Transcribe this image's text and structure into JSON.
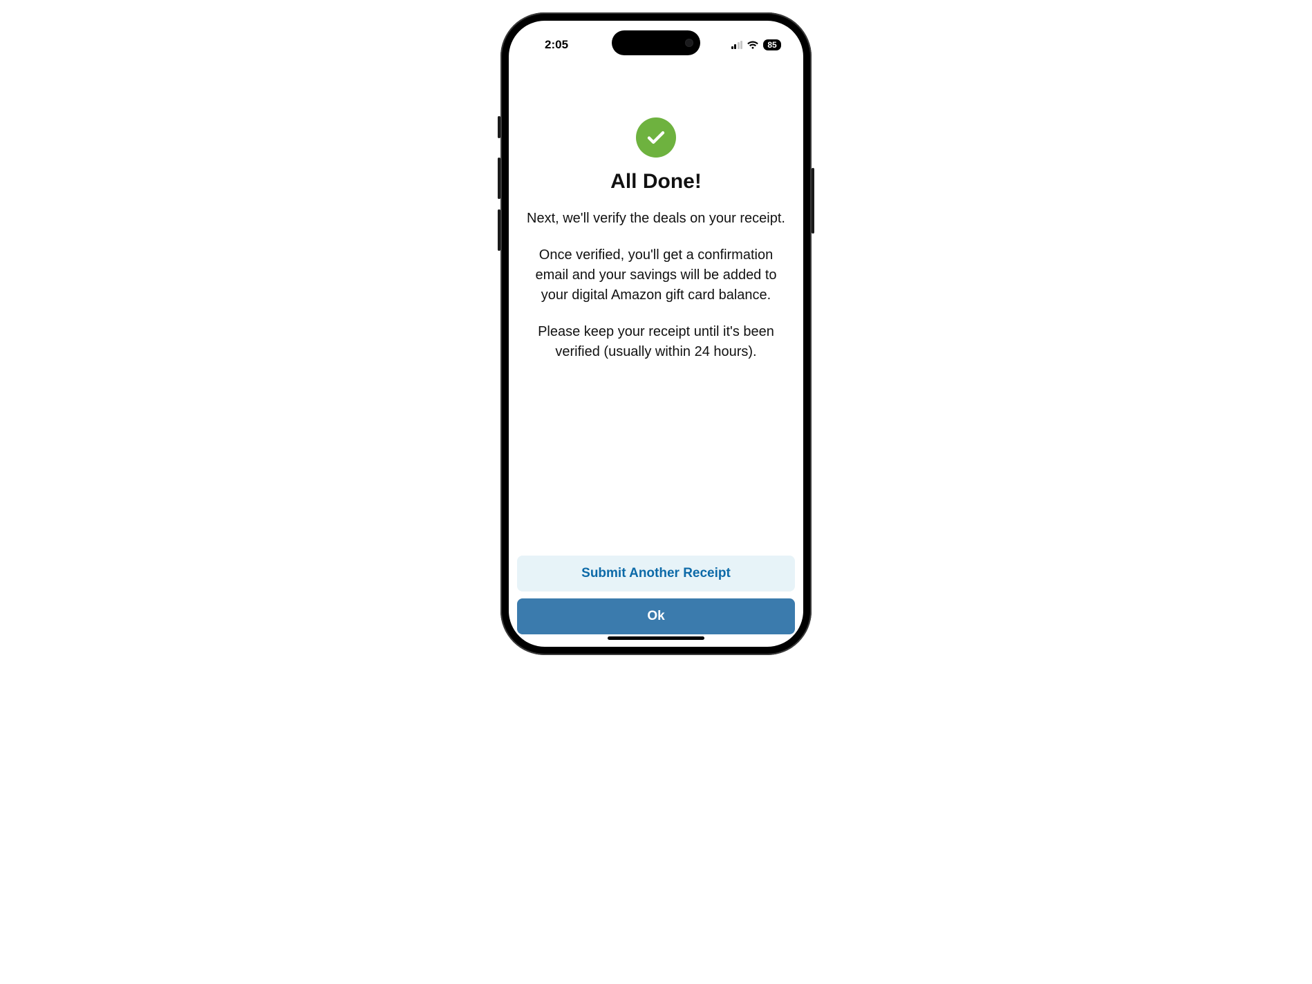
{
  "status_bar": {
    "time": "2:05",
    "battery": "85"
  },
  "content": {
    "icon": "check-circle",
    "title": "All Done!",
    "para1": "Next, we'll verify the deals on your receipt.",
    "para2": "Once verified, you'll get a confirmation email and your savings will be added to your digital Amazon gift card balance.",
    "para3": "Please keep your receipt until it's been verified (usually within 24 hours)."
  },
  "buttons": {
    "secondary": "Submit Another Receipt",
    "primary": "Ok"
  },
  "colors": {
    "check_bg": "#6eb23f",
    "btn_secondary_bg": "#e7f3f8",
    "btn_secondary_fg": "#0d6aa8",
    "btn_primary_bg": "#3b7bad",
    "btn_primary_fg": "#ffffff"
  }
}
